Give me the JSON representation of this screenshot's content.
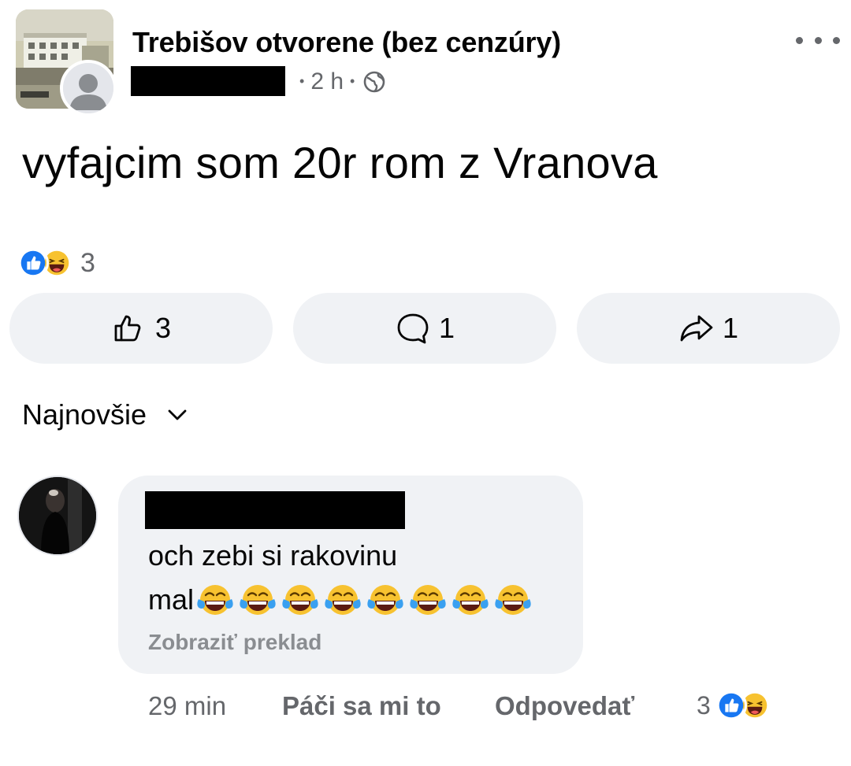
{
  "post": {
    "group_name": "Trebišov otvorene (bez cenzúry)",
    "time": "2 h",
    "text": "vyfajcim som 20r rom z Vranova"
  },
  "icons": {
    "privacy": "globe-icon",
    "more": "more-horizontal-icon",
    "reactions": [
      "like-icon",
      "haha-icon"
    ],
    "comment_emoji": "face-with-tears-of-joy-emoji"
  },
  "reactions": {
    "count": "3"
  },
  "actions": {
    "like_count": "3",
    "comment_count": "1",
    "share_count": "1"
  },
  "comments_section": {
    "sort_label": "Najnovšie"
  },
  "comment": {
    "line1": "och zebi si rakovinu",
    "line2": "mal",
    "emoji_count": 8,
    "see_translation": "Zobraziť preklad",
    "time": "29 min",
    "like_label": "Páči sa mi to",
    "reply_label": "Odpovedať",
    "reaction_count": "3"
  },
  "colors": {
    "like_blue": "#1877f2",
    "secondary_text": "#65676b",
    "pill_background": "#f0f2f5",
    "haha_yellow": "#f7c230"
  }
}
